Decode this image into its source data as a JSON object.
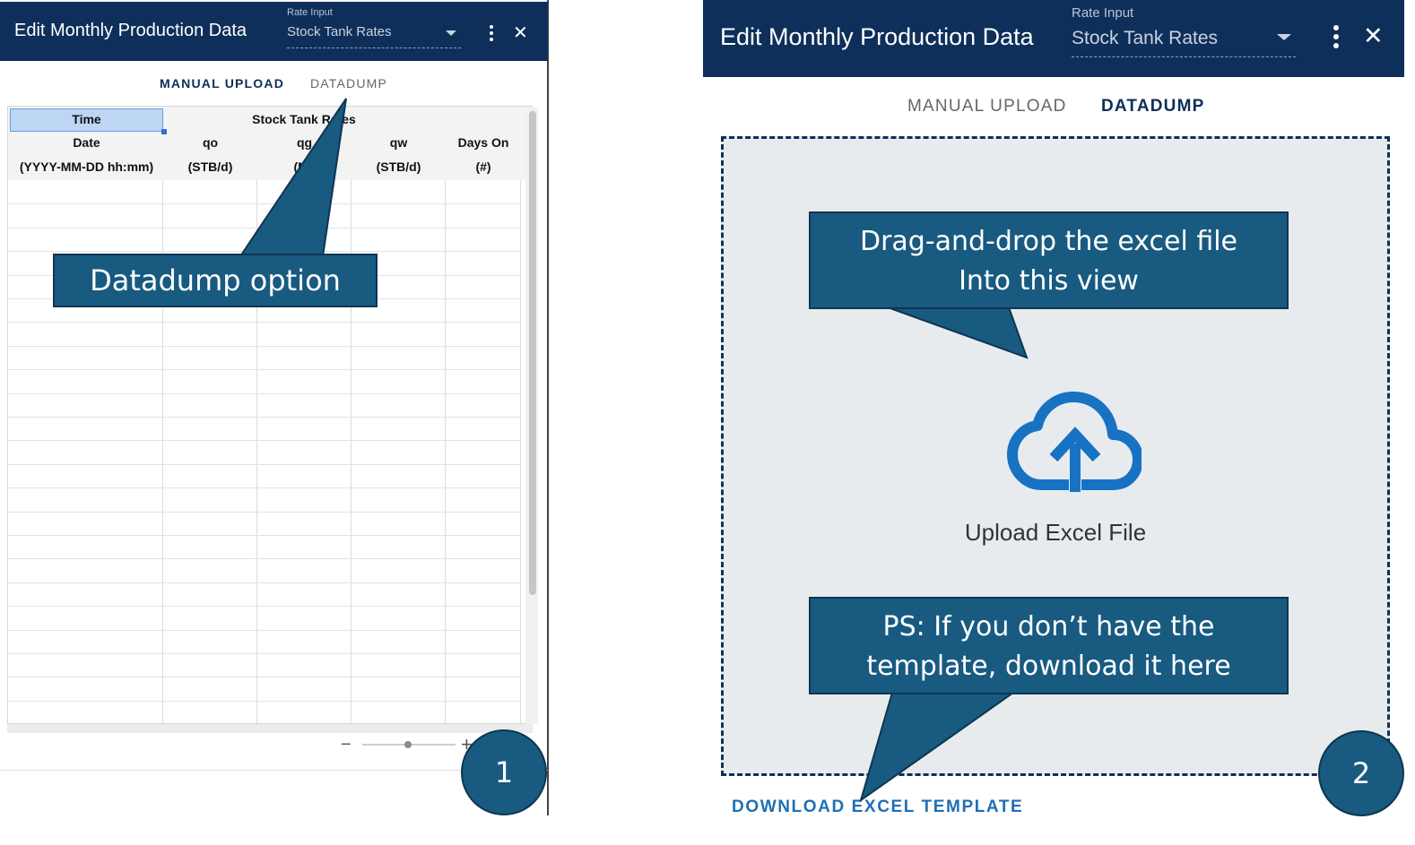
{
  "left_panel": {
    "header": {
      "title": "Edit Monthly Production Data",
      "rate_input_label": "Rate Input",
      "rate_input_value": "Stock Tank Rates"
    },
    "tabs": [
      {
        "label": "MANUAL UPLOAD",
        "active": true
      },
      {
        "label": "DATADUMP",
        "active": false
      }
    ],
    "table": {
      "group_headers": [
        "Time",
        "Stock Tank Rates"
      ],
      "column_headers": [
        "Date",
        "qo",
        "qg",
        "qw",
        "Days On"
      ],
      "column_units": [
        "(YYYY-MM-DD hh:mm)",
        "(STB/d)",
        "(Ms",
        "(STB/d)",
        "(#)"
      ],
      "rows": 23
    },
    "zoom": {
      "minus": "−",
      "plus": "+"
    },
    "callout": "Datadump option",
    "badge": "1"
  },
  "right_panel": {
    "header": {
      "title": "Edit Monthly Production Data",
      "rate_input_label": "Rate Input",
      "rate_input_value": "Stock Tank Rates"
    },
    "tabs": [
      {
        "label": "MANUAL UPLOAD",
        "active": false
      },
      {
        "label": "DATADUMP",
        "active": true
      }
    ],
    "upload_text": "Upload Excel File",
    "download_link": "DOWNLOAD EXCEL TEMPLATE",
    "callout_top": [
      "Drag-and-drop the excel file",
      "Into this view"
    ],
    "callout_bottom": [
      "PS: If you don’t have the",
      "template, download it here"
    ],
    "badge": "2"
  },
  "colors": {
    "header_bg": "#0e2f5a",
    "callout_bg": "#185a80",
    "accent_blue": "#1f6fb5",
    "active_tab": "#0e2f5a",
    "inactive_tab": "#666666"
  },
  "icons": [
    "more-vert-icon",
    "close-icon",
    "dropdown-caret-icon",
    "cloud-upload-icon"
  ]
}
